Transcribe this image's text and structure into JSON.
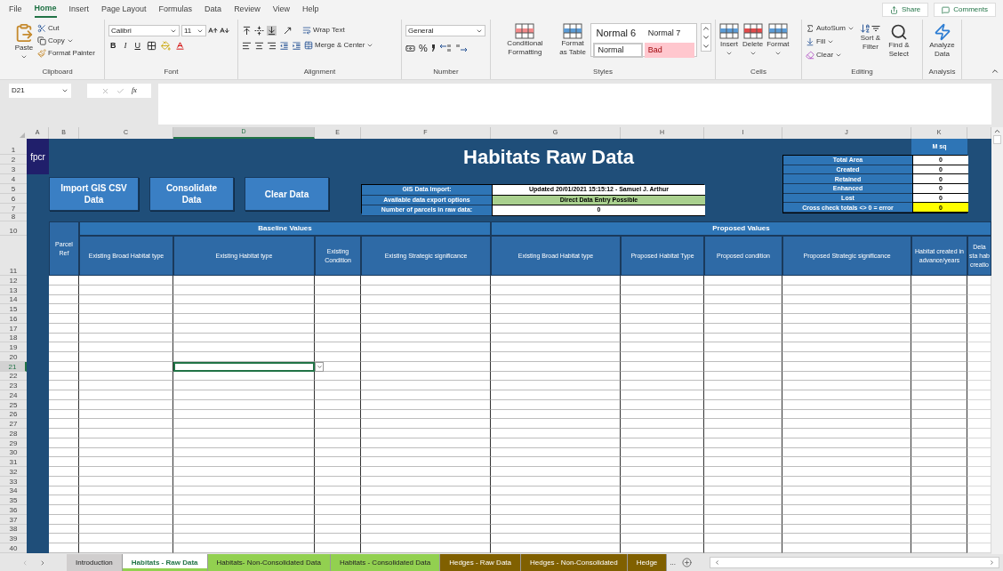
{
  "menu_tabs": [
    {
      "label": "File",
      "selected": false
    },
    {
      "label": "Home",
      "selected": true
    },
    {
      "label": "Insert",
      "selected": false
    },
    {
      "label": "Page Layout",
      "selected": false
    },
    {
      "label": "Formulas",
      "selected": false
    },
    {
      "label": "Data",
      "selected": false
    },
    {
      "label": "Review",
      "selected": false
    },
    {
      "label": "View",
      "selected": false
    },
    {
      "label": "Help",
      "selected": false
    }
  ],
  "top_buttons": {
    "share": "Share",
    "comments": "Comments"
  },
  "ribbon": {
    "clipboard": {
      "title": "Clipboard",
      "paste": "Paste",
      "cut": "Cut",
      "copy": "Copy",
      "format_painter": "Format Painter"
    },
    "font": {
      "title": "Font",
      "font_name": "Calibri",
      "font_size": "11",
      "bold": "B",
      "italic": "I",
      "underline": "U"
    },
    "alignment": {
      "title": "Alignment",
      "wrap_text": "Wrap Text",
      "merge_center": "Merge & Center"
    },
    "number": {
      "title": "Number",
      "format": "General",
      "percent": "%"
    },
    "styles": {
      "title": "Styles",
      "conditional_formatting": "Conditional Formatting",
      "format_as_table": "Format as Table",
      "cell_styles": [
        {
          "label": "Normal 6",
          "kind": "large"
        },
        {
          "label": "Normal 7",
          "kind": "plain"
        },
        {
          "label": "Normal",
          "kind": "current"
        },
        {
          "label": "Bad",
          "kind": "bad"
        }
      ]
    },
    "cells": {
      "title": "Cells",
      "insert": "Insert",
      "delete": "Delete",
      "format": "Format"
    },
    "editing": {
      "title": "Editing",
      "autosum": "AutoSum",
      "fill": "Fill",
      "clear": "Clear",
      "sort_filter": "Sort & Filter",
      "find_select": "Find & Select"
    },
    "analysis": {
      "title": "Analysis",
      "analyze_data": "Analyze Data"
    }
  },
  "formula_bar": {
    "name_box": "D21",
    "function_label": "fx"
  },
  "sheet": {
    "columns": [
      {
        "label": "A",
        "selected": false
      },
      {
        "label": "B",
        "selected": false
      },
      {
        "label": "C",
        "selected": false
      },
      {
        "label": "D",
        "selected": true
      },
      {
        "label": "E",
        "selected": false
      },
      {
        "label": "F",
        "selected": false
      },
      {
        "label": "G",
        "selected": false
      },
      {
        "label": "H",
        "selected": false
      },
      {
        "label": "I",
        "selected": false
      },
      {
        "label": "J",
        "selected": false
      },
      {
        "label": "K",
        "selected": false
      }
    ],
    "rows": [
      {
        "label": "1",
        "selected": false
      },
      {
        "label": "2",
        "selected": false
      },
      {
        "label": "3",
        "selected": false
      },
      {
        "label": "4",
        "selected": false
      },
      {
        "label": "5",
        "selected": false
      },
      {
        "label": "6",
        "selected": false
      },
      {
        "label": "7",
        "selected": false
      },
      {
        "label": "8",
        "selected": false
      },
      {
        "label": "10",
        "selected": false
      },
      {
        "label": "11",
        "selected": false
      },
      {
        "label": "12",
        "selected": false
      },
      {
        "label": "13",
        "selected": false
      },
      {
        "label": "14",
        "selected": false
      },
      {
        "label": "15",
        "selected": false
      },
      {
        "label": "16",
        "selected": false
      },
      {
        "label": "17",
        "selected": false
      },
      {
        "label": "18",
        "selected": false
      },
      {
        "label": "19",
        "selected": false
      },
      {
        "label": "20",
        "selected": false
      },
      {
        "label": "21",
        "selected": true
      },
      {
        "label": "22",
        "selected": false
      },
      {
        "label": "23",
        "selected": false
      },
      {
        "label": "24",
        "selected": false
      },
      {
        "label": "25",
        "selected": false
      },
      {
        "label": "26",
        "selected": false
      },
      {
        "label": "27",
        "selected": false
      },
      {
        "label": "28",
        "selected": false
      },
      {
        "label": "29",
        "selected": false
      },
      {
        "label": "30",
        "selected": false
      },
      {
        "label": "31",
        "selected": false
      },
      {
        "label": "32",
        "selected": false
      },
      {
        "label": "33",
        "selected": false
      },
      {
        "label": "34",
        "selected": false
      },
      {
        "label": "35",
        "selected": false
      },
      {
        "label": "36",
        "selected": false
      },
      {
        "label": "37",
        "selected": false
      },
      {
        "label": "38",
        "selected": false
      },
      {
        "label": "39",
        "selected": false
      },
      {
        "label": "40",
        "selected": false
      }
    ],
    "logo": "fpcr",
    "title": "Habitats Raw Data",
    "buttons": [
      "Import GIS CSV Data",
      "Consolidate Data",
      "Clear Data"
    ],
    "info": [
      {
        "label": "GIS Data Import:",
        "value": "Updated 20/01/2021 15:15:12 - Samuel J. Arthur",
        "kind": "plain"
      },
      {
        "label": "Available data export options",
        "value": "Direct Data Entry Possible",
        "kind": "ok"
      },
      {
        "label": "Number of parcels in raw data:",
        "value": "0",
        "kind": "plain"
      }
    ],
    "totals_unit": "M sq",
    "totals": [
      {
        "label": "Total Area",
        "value": "0",
        "kind": "plain"
      },
      {
        "label": "Created",
        "value": "0",
        "kind": "plain"
      },
      {
        "label": "Retained",
        "value": "0",
        "kind": "plain"
      },
      {
        "label": "Enhanced",
        "value": "0",
        "kind": "plain"
      },
      {
        "label": "Lost",
        "value": "0",
        "kind": "plain"
      },
      {
        "label": "Cross check totals <> 0 = error",
        "value": "0",
        "kind": "check"
      }
    ],
    "parcel_ref": "Parcel Ref",
    "baseline": {
      "title": "Baseline Values",
      "columns": [
        "Existing Broad Habitat type",
        "Existing Habitat type",
        "Existing Condition",
        "Existing Strategic significance"
      ]
    },
    "proposed": {
      "title": "Proposed Values",
      "columns": [
        "Existing Broad Habitat type",
        "Proposed Habitat Type",
        "Proposed condition",
        "Proposed Strategic significance",
        "Habitat created in advance/years",
        "Dela sta hab creatio"
      ]
    }
  },
  "sheet_tabs": [
    {
      "label": "Introduction",
      "color": "#d0cece",
      "selected": false
    },
    {
      "label": "Habitats - Raw Data",
      "color": "#92d050",
      "selected": true
    },
    {
      "label": "Habitats- Non-Consolidated Data",
      "color": "#92d050",
      "selected": false
    },
    {
      "label": "Habitats - Consolidated Data",
      "color": "#92d050",
      "selected": false
    },
    {
      "label": "Hedges - Raw Data",
      "color": "#806000",
      "selected": false
    },
    {
      "label": "Hedges - Non-Consolidated",
      "color": "#806000",
      "selected": false
    },
    {
      "label": "Hedge",
      "color": "#806000",
      "selected": false
    }
  ],
  "more_tabs": "..."
}
